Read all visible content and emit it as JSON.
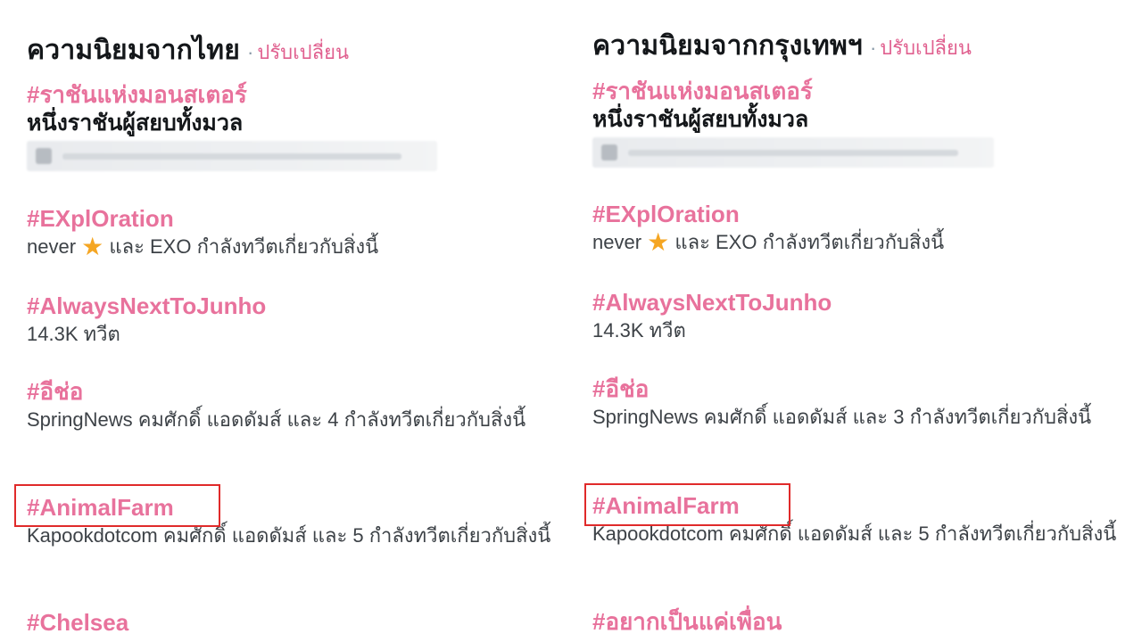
{
  "left_panel": {
    "title": "ความนิยมจากไทย",
    "separator": "·",
    "change_label": "ปรับเปลี่ยน",
    "trends": [
      {
        "name": "#ราชันแห่งมอนสเตอร์",
        "desc": "หนึ่งราชันผู้สยบทั้งมวล",
        "promoted": true
      },
      {
        "name": "#EXplOration",
        "desc_before": "never",
        "desc_icon": "star-icon",
        "desc_after": "และ EXO กำลังทวีตเกี่ยวกับสิ่งนี้"
      },
      {
        "name": "#AlwaysNextToJunho",
        "desc": "14.3K ทวีต"
      },
      {
        "name": "#อีช่อ",
        "desc": "SpringNews คมศักดิ์ แอดดัมส์ และ 4 กำลังทวีตเกี่ยวกับสิ่งนี้"
      },
      {
        "name": "#AnimalFarm",
        "desc": "Kapookdotcom คมศักดิ์ แอดดัมส์ และ 5 กำลังทวีตเกี่ยวกับสิ่งนี้",
        "highlighted": true
      },
      {
        "name": "#Chelsea"
      }
    ]
  },
  "right_panel": {
    "title": "ความนิยมจากกรุงเทพฯ",
    "separator": "·",
    "change_label": "ปรับเปลี่ยน",
    "trends": [
      {
        "name": "#ราชันแห่งมอนสเตอร์",
        "desc": "หนึ่งราชันผู้สยบทั้งมวล",
        "promoted": true
      },
      {
        "name": "#EXplOration",
        "desc_before": "never",
        "desc_icon": "star-icon",
        "desc_after": "และ EXO กำลังทวีตเกี่ยวกับสิ่งนี้"
      },
      {
        "name": "#AlwaysNextToJunho",
        "desc": "14.3K ทวีต"
      },
      {
        "name": "#อีช่อ",
        "desc": "SpringNews คมศักดิ์ แอดดัมส์ และ 3 กำลังทวีตเกี่ยวกับสิ่งนี้"
      },
      {
        "name": "#AnimalFarm",
        "desc": "Kapookdotcom คมศักดิ์ แอดดัมส์ และ 5 กำลังทวีตเกี่ยวกับสิ่งนี้",
        "highlighted": true
      },
      {
        "name": "#อยากเป็นแค่เพื่อน"
      }
    ]
  },
  "colors": {
    "trend_pink": "#e8729c",
    "highlight_red": "#e02a2a",
    "star_orange": "#f5a623"
  },
  "icons": {
    "star": "★"
  }
}
